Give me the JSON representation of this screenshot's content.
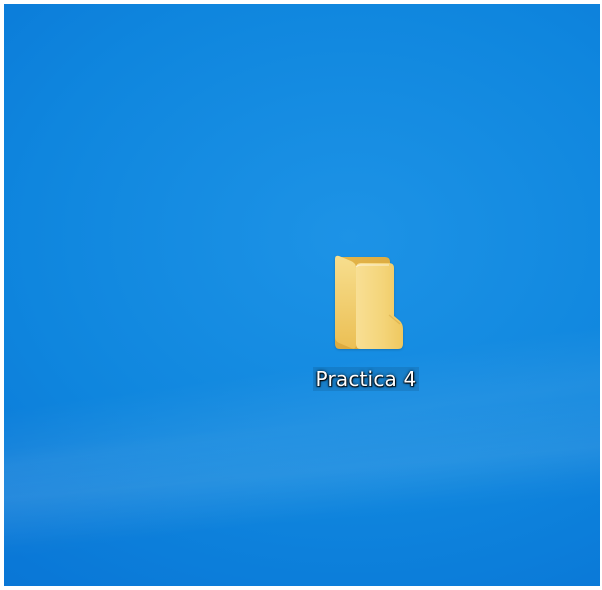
{
  "desktop": {
    "icons": [
      {
        "label": "Practica 4",
        "icon": "folder-icon"
      }
    ]
  },
  "colors": {
    "background_primary": "#0a78d7",
    "background_highlight": "#1d93e6",
    "folder_light": "#f7dc8c",
    "folder_mid": "#f0c85c",
    "folder_dark": "#d9a93a"
  }
}
